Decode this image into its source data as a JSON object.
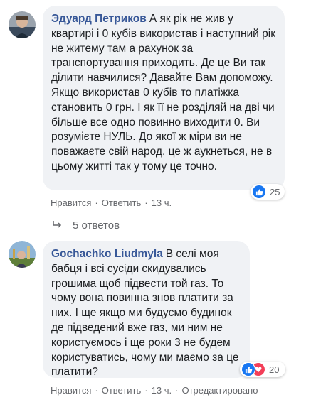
{
  "comments": [
    {
      "author": "Эдуард Петриков",
      "text": "А як рік не жив у квартирі і 0 кубів використав і наступний рік не житему там а рахунок за транспортування приходить. Де це Ви так ділити навчилися? Давайте Вам допоможу. Якщо використав 0 кубів то платіжка становить 0 грн. І як її не розділяй на дві чи більше все одно повинно виходити 0. Ви розумієте НУЛЬ. До якої ж міри ви не поважаєте свій народ, це ж аукнеться, не в цьому житті так у тому це точно.",
      "like_label": "Нравится",
      "reply_label": "Ответить",
      "time": "13 ч.",
      "reaction_count": "25",
      "reactions": [
        "like-icon"
      ],
      "replies_label": "5 ответов"
    },
    {
      "author": "Gochachko Liudmyla",
      "text": "В селі моя бабця і всі сусіди скидувались грошима щоб підвести той газ. То чому вона повинна знов платити за них. І ще якщо ми будуємо будинок де підведений вже газ, ми ним не користуємось і ще роки 3 не будем користуватись, чому ми маємо за це платити?",
      "like_label": "Нравится",
      "reply_label": "Ответить",
      "time": "13 ч.",
      "edited_label": "Отредактировано",
      "reaction_count": "20",
      "reactions": [
        "like-icon",
        "love-icon"
      ]
    }
  ],
  "colors": {
    "author": "#385898",
    "bubble": "#f0f2f5",
    "secondary_text": "#65676b",
    "like": "#1877f2",
    "love": "#f33e58"
  }
}
